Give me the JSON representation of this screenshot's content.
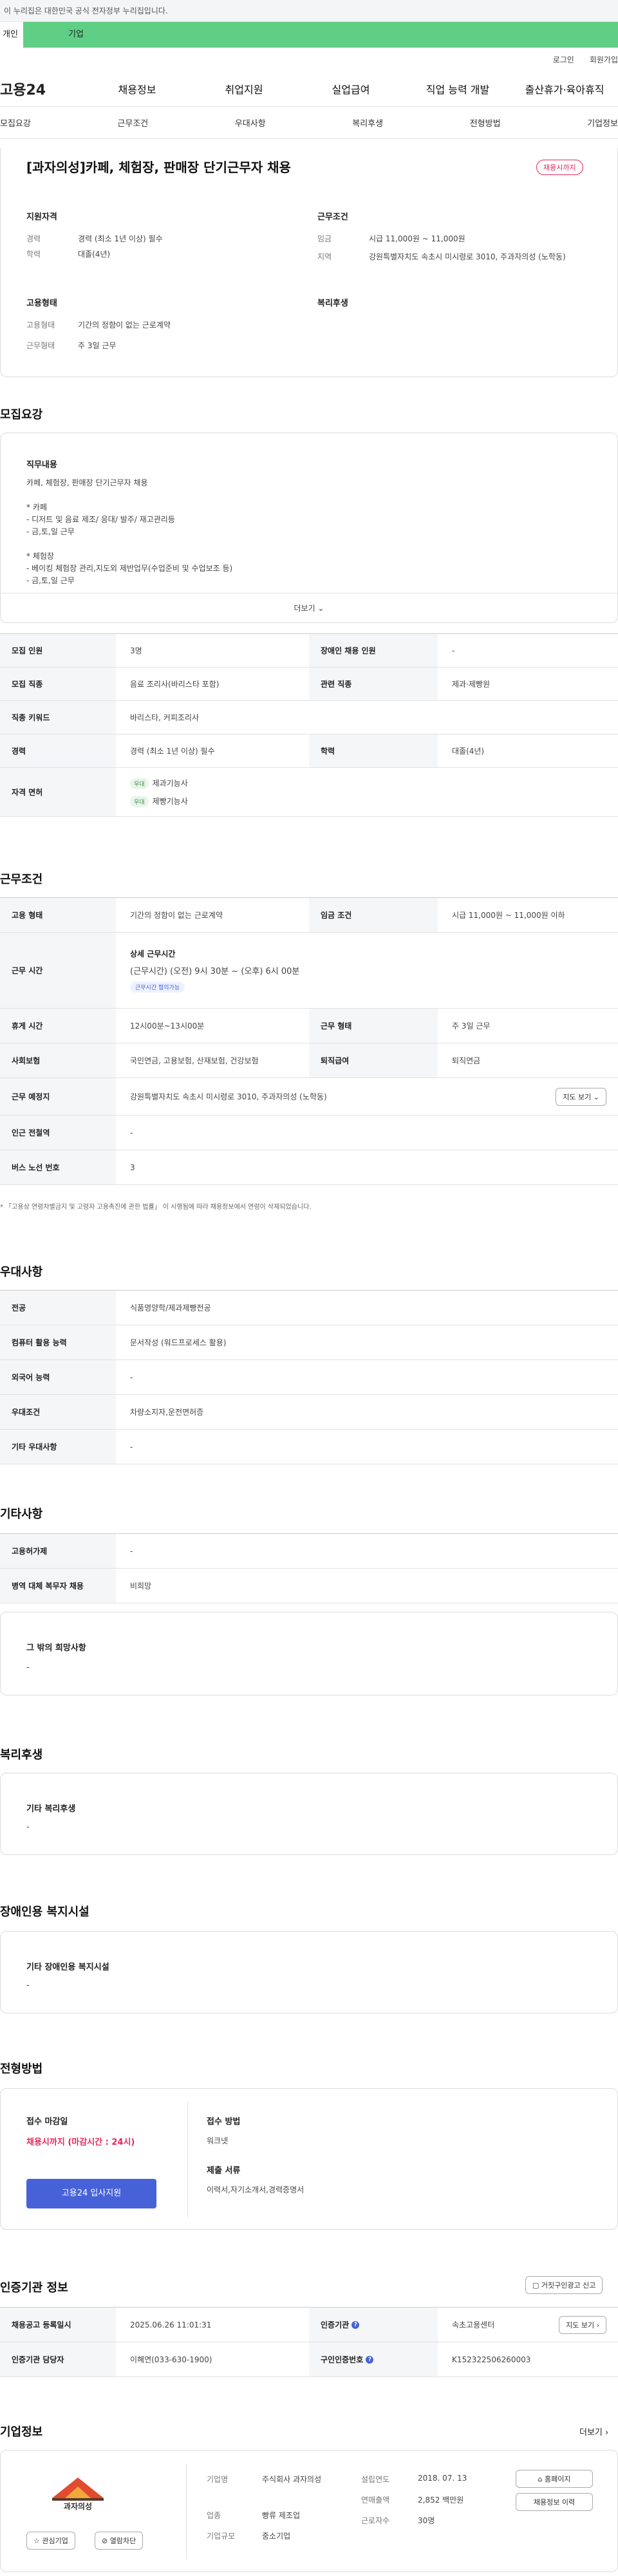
{
  "gov_banner": "이 누리집은 대한민국 공식 전자정부 누리집입니다.",
  "tabs": {
    "person": "개인",
    "corp": "기업"
  },
  "util": {
    "login": "로그인",
    "join": "회원가입"
  },
  "logo": "고용24",
  "gnb": [
    "채용정보",
    "취업지원",
    "실업급여",
    "직업 능력 개발",
    "출산휴가·육아휴직"
  ],
  "subnav": [
    "모집요강",
    "근무조건",
    "우대사항",
    "복리후생",
    "전형방법",
    "기업정보"
  ],
  "title": "[과자의성]카페, 체험장, 판매장 단기근무자 채용",
  "status_badge": "채용시까지",
  "summary": {
    "qual_title": "지원자격",
    "cond_title": "근무조건",
    "emp_title": "고용형태",
    "welfare_title": "복리후생",
    "career_k": "경력",
    "career_v": "경력 (최소 1년 이상) 필수",
    "edu_k": "학력",
    "edu_v": "대졸(4년)",
    "wage_k": "임금",
    "wage_v": "시급 11,000원 ~ 11,000원",
    "region_k": "지역",
    "region_v": "강원특별자치도 속초시 미시령로 3010, 주과자의성 (노학동)",
    "type_k": "고용형태",
    "type_v": "기간의 정함이 없는 근로계약",
    "shift_k": "근무형태",
    "shift_v": "주 3일 근무"
  },
  "recruit": {
    "section": "모집요강",
    "job_title": "직무내용",
    "job_lines": [
      "카페, 체험장, 판매장 단기근무자 채용",
      "",
      "* 카페",
      "- 디저트 및 음료 제조/ 응대/ 발주/ 재고관리등",
      "- 금,토,일 근무",
      "",
      "* 체험장",
      "- 베이킹 체험장 관리,지도외 제반업무(수업준비 및 수업보조 등)",
      "- 금,토,일 근무"
    ],
    "more": "더보기",
    "rows": [
      {
        "k1": "모집 인원",
        "v1": "3명",
        "k2": "장애인 채용 인원",
        "v2": "-"
      },
      {
        "k1": "모집 직종",
        "v1": "음료 조리사(바리스타 포함)",
        "k2": "관련 직종",
        "v2": "제과·제빵원"
      },
      {
        "k1": "직종 키워드",
        "v1": "바리스타, 커피조리사"
      },
      {
        "k1": "경력",
        "v1": "경력 (최소 1년 이상) 필수",
        "k2": "학력",
        "v2": "대졸(4년)"
      }
    ],
    "license_k": "자격 면허",
    "licenses": [
      {
        "badge": "우대",
        "name": "제과기능사"
      },
      {
        "badge": "우대",
        "name": "제빵기능사"
      }
    ]
  },
  "work": {
    "section": "근무조건",
    "type_k": "고용 형태",
    "type_v": "기간의 정함이 없는 근로계약",
    "wage_k": "임금 조건",
    "wage_v": "시급 11,000원 ~ 11,000원 이하",
    "time_k": "근무 시간",
    "time_title": "상세 근무시간",
    "time_v": "(근무시간) (오전) 9시 30분 ~ (오후) 6시 00분",
    "time_badge": "근무시간 협의가능",
    "rest_k": "휴게 시간",
    "rest_v": "12시00분~13시00분",
    "shift_k": "근무 형태",
    "shift_v": "주 3일 근무",
    "ins_k": "사회보험",
    "ins_v": "국민연금, 고용보험, 산재보험, 건강보험",
    "ret_k": "퇴직급여",
    "ret_v": "퇴직연금",
    "place_k": "근무 예정지",
    "place_v": "강원특별자치도 속초시 미시령로 3010, 주과자의성 (노학동)",
    "map_btn": "지도 보기",
    "subway_k": "인근 전철역",
    "subway_v": "-",
    "bus_k": "버스 노선 번호",
    "bus_v": "3",
    "note": "* 「고용상 연령차별금지 및 고령자 고용촉진에 관한 법률」 이 시행됨에 따라 채용정보에서 연령이 삭제되었습니다."
  },
  "pref": {
    "section": "우대사항",
    "rows": [
      {
        "k": "전공",
        "v": "식품영양학/제과제빵전공"
      },
      {
        "k": "컴퓨터 활용 능력",
        "v": "문서작성 (워드프로세스 활용)"
      },
      {
        "k": "외국어 능력",
        "v": "-"
      },
      {
        "k": "우대조건",
        "v": "차량소지자,운전면허증"
      },
      {
        "k": "기타 우대사항",
        "v": "-"
      }
    ]
  },
  "etc": {
    "section": "기타사항",
    "rows": [
      {
        "k": "고용허가제",
        "v": "-"
      },
      {
        "k": "병역 대체 복무자 채용",
        "v": "비희망"
      }
    ],
    "wish_title": "그 밖의 희망사항",
    "wish_v": "-"
  },
  "welfare": {
    "section": "복리후생",
    "title": "기타 복리후생",
    "v": "-"
  },
  "disabled": {
    "section": "장애인용 복지시설",
    "title": "기타 장애인용 복지시설",
    "v": "-"
  },
  "process": {
    "section": "전형방법",
    "deadline_k": "접수 마감일",
    "deadline_v": "채용시까지 (마감시간 : 24시)",
    "apply_btn": "고용24 입사지원",
    "method_k": "접수 방법",
    "method_v": "워크넷",
    "docs_k": "제출 서류",
    "docs_v": "이력서,자기소개서,경력증명서"
  },
  "cert": {
    "section": "인증기관 정보",
    "report_btn": "거짓구인광고 신고",
    "date_k": "채용공고 등록일시",
    "date_v": "2025.06.26 11:01:31",
    "org_k": "인증기관",
    "org_v": "속초고용센터",
    "map_btn": "지도 보기",
    "mgr_k": "인증기관 담당자",
    "mgr_v": "이혜연(033-630-1900)",
    "id_k": "구인인증번호",
    "id_v": "K152322506260003"
  },
  "company": {
    "section": "기업정보",
    "more": "더보기",
    "logo_text": "과자의성",
    "interest_btn": "관심기업",
    "block_btn": "열람차단",
    "name_k": "기업명",
    "name_v": "주식회사 과자의성",
    "industry_k": "업종",
    "industry_v": "빵류 제조업",
    "size_k": "기업규모",
    "size_v": "중소기업",
    "year_k": "설립연도",
    "year_v": "2018. 07. 13",
    "sales_k": "연매출액",
    "sales_v": "2,852 백만원",
    "emp_k": "근로자수",
    "emp_v": "30명",
    "home_btn": "홈페이지",
    "jobs_btn": "채용정보 이력"
  },
  "colors": {
    "accent": "#5fcf86",
    "primary": "#4762d8",
    "alert": "#e3285a"
  }
}
